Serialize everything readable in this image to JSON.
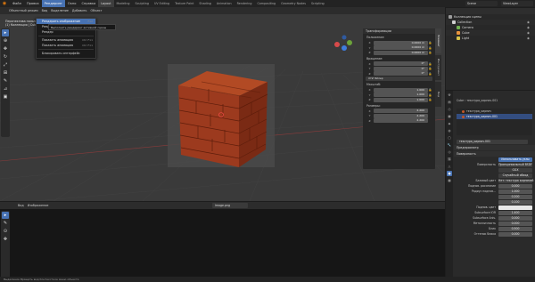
{
  "topbar": {
    "menus": [
      "Файл",
      "Правка",
      "Рендеринг",
      "Окно",
      "Справка"
    ],
    "active_menu_index": 2,
    "workspaces": [
      "Layout",
      "Modeling",
      "Sculpting",
      "UV Editing",
      "Texture Paint",
      "Shading",
      "Animation",
      "Rendering",
      "Compositing",
      "Geometry Nodes",
      "Scripting"
    ],
    "active_workspace_index": 0,
    "scene": "Scene",
    "view_layer": "ViewLayer"
  },
  "dropdown": {
    "items": [
      {
        "label": "Рендерить изображение",
        "key": "F12"
      },
      {
        "label": "Рендерить анимацию",
        "key": "Ctrl F12"
      },
      {
        "label": "Рендер",
        "key": ""
      },
      {
        "label": "Показать анимацию",
        "key": "Ctrl F11"
      },
      {
        "label": "Показать анимацию",
        "key": "Ctrl F11"
      },
      {
        "label": "Блокировать интерфейс",
        "key": ""
      }
    ],
    "tooltip": "Выполнить рендеринг активной сцены"
  },
  "viewport": {
    "mode": "Объектный режим",
    "view_label": "Вид",
    "select_label": "Выделение",
    "add_label": "Добавить",
    "object_label": "Объект",
    "info_line1": "Перспектива пользователя",
    "info_line2": "(1) Коллекция | Cube"
  },
  "npanel": {
    "header": "Трансформации",
    "location_label": "Положение:",
    "location": [
      "0.0000 m",
      "0.0000 m",
      "0.0000 m"
    ],
    "rotation_label": "Вращение:",
    "rotation": [
      "0°",
      "0°",
      "0°"
    ],
    "mode": "XYZ Эйлер",
    "scale_label": "Масштаб:",
    "scale": [
      "1.000",
      "1.000",
      "1.000"
    ],
    "dimensions_label": "Размеры:",
    "dimensions": [
      "2.200",
      "2.200",
      "2.200"
    ],
    "axes": [
      "X",
      "Y",
      "Z"
    ],
    "tabs": [
      "Элемент",
      "Инструмент",
      "Вид"
    ]
  },
  "image_editor": {
    "view": "Вид",
    "image_menu": "Изображение",
    "image_name": "Image.png"
  },
  "outliner": {
    "rows": [
      {
        "label": "Коллекция сцены",
        "indent": 0,
        "color": "#9d9d9d"
      },
      {
        "label": "Collection",
        "indent": 1,
        "color": "#cfcfcf"
      },
      {
        "label": "Camera",
        "indent": 2,
        "color": "#6fb04f"
      },
      {
        "label": "Cube",
        "indent": 2,
        "color": "#e8933c"
      },
      {
        "label": "Light",
        "indent": 2,
        "color": "#d8c44a"
      }
    ]
  },
  "properties": {
    "object_name": "Cube",
    "material_name": "текстура_кирпич.001",
    "slots": [
      "текстура_кирпич",
      "текстура_кирпич.001"
    ],
    "selected_slot": 1,
    "material_field": "текстура_кирпич.001",
    "preview_label": "Предпросмотр",
    "surface_label": "Поверхность",
    "use_nodes": "Использовать узлы",
    "surface_row_label": "Поверхность",
    "surface_value": "Принципиальный BSDF",
    "ggx": "GGX",
    "sss_method": "Случайный обход",
    "base_color_label": "Базовый цвет",
    "base_color_value": "Нет: текстура кирпичей",
    "rows": [
      {
        "label": "Подпов. рассеяние",
        "value": "0.000"
      },
      {
        "label": "Радиус подпов...",
        "value": "1.000"
      },
      {
        "label": "",
        "value": "0.200"
      },
      {
        "label": "",
        "value": "0.100"
      },
      {
        "label": "Подпов. цвет",
        "value": ""
      },
      {
        "label": "Subsurface IOR",
        "value": "1.400"
      },
      {
        "label": "Subsurface Anis.",
        "value": "0.000"
      },
      {
        "label": "Металличность",
        "value": "0.000"
      },
      {
        "label": "Блик",
        "value": "0.500"
      },
      {
        "label": "Оттенок блика",
        "value": "0.000"
      }
    ]
  },
  "statusbar": {
    "text": "Выделение    Вращать вид    Контекстное меню объекта"
  },
  "colors": {
    "accent": "#4772b3",
    "brick": "#9c3a1e"
  }
}
